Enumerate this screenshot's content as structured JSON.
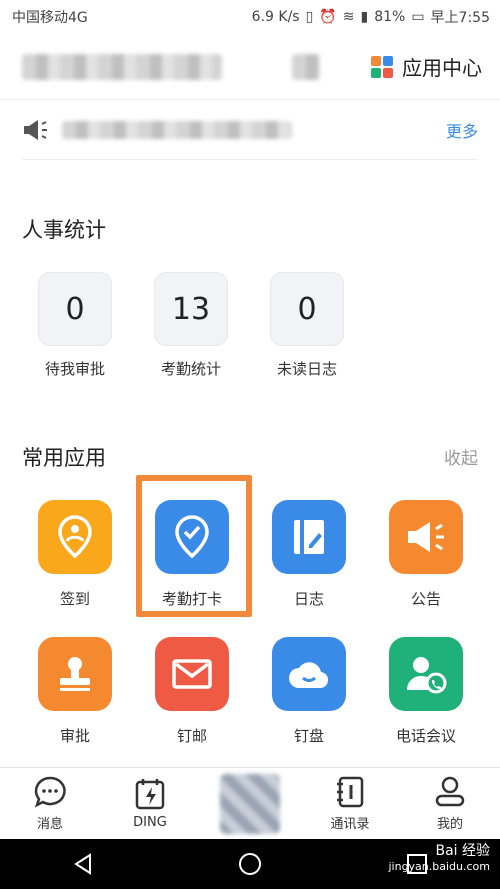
{
  "status": {
    "carrier": "中国移动4G",
    "speed": "6.9 K/s",
    "battery": "81%",
    "time": "早上7:55"
  },
  "header": {
    "app_center": "应用中心"
  },
  "notice": {
    "more": "更多"
  },
  "hr": {
    "title": "人事统计",
    "stats": [
      {
        "value": "0",
        "label": "待我审批"
      },
      {
        "value": "13",
        "label": "考勤统计"
      },
      {
        "value": "0",
        "label": "未读日志"
      }
    ]
  },
  "apps": {
    "title": "常用应用",
    "collapse": "收起",
    "items": [
      {
        "label": "签到",
        "color": "#f9a81b",
        "icon": "location-pin-icon"
      },
      {
        "label": "考勤打卡",
        "color": "#3a8be8",
        "icon": "check-pin-icon"
      },
      {
        "label": "日志",
        "color": "#3a8be8",
        "icon": "journal-icon"
      },
      {
        "label": "公告",
        "color": "#f5892f",
        "icon": "megaphone-icon"
      },
      {
        "label": "审批",
        "color": "#f5892f",
        "icon": "stamp-icon"
      },
      {
        "label": "钉邮",
        "color": "#ee5a44",
        "icon": "mail-icon"
      },
      {
        "label": "钉盘",
        "color": "#3a8be8",
        "icon": "cloud-icon"
      },
      {
        "label": "电话会议",
        "color": "#20b07a",
        "icon": "phone-meeting-icon"
      }
    ]
  },
  "tabs": {
    "messages": "消息",
    "ding": "DING",
    "contacts": "通讯录",
    "me": "我的"
  },
  "watermark": {
    "line1": "Bai 经验",
    "line2": "jingyan.baidu.com"
  }
}
